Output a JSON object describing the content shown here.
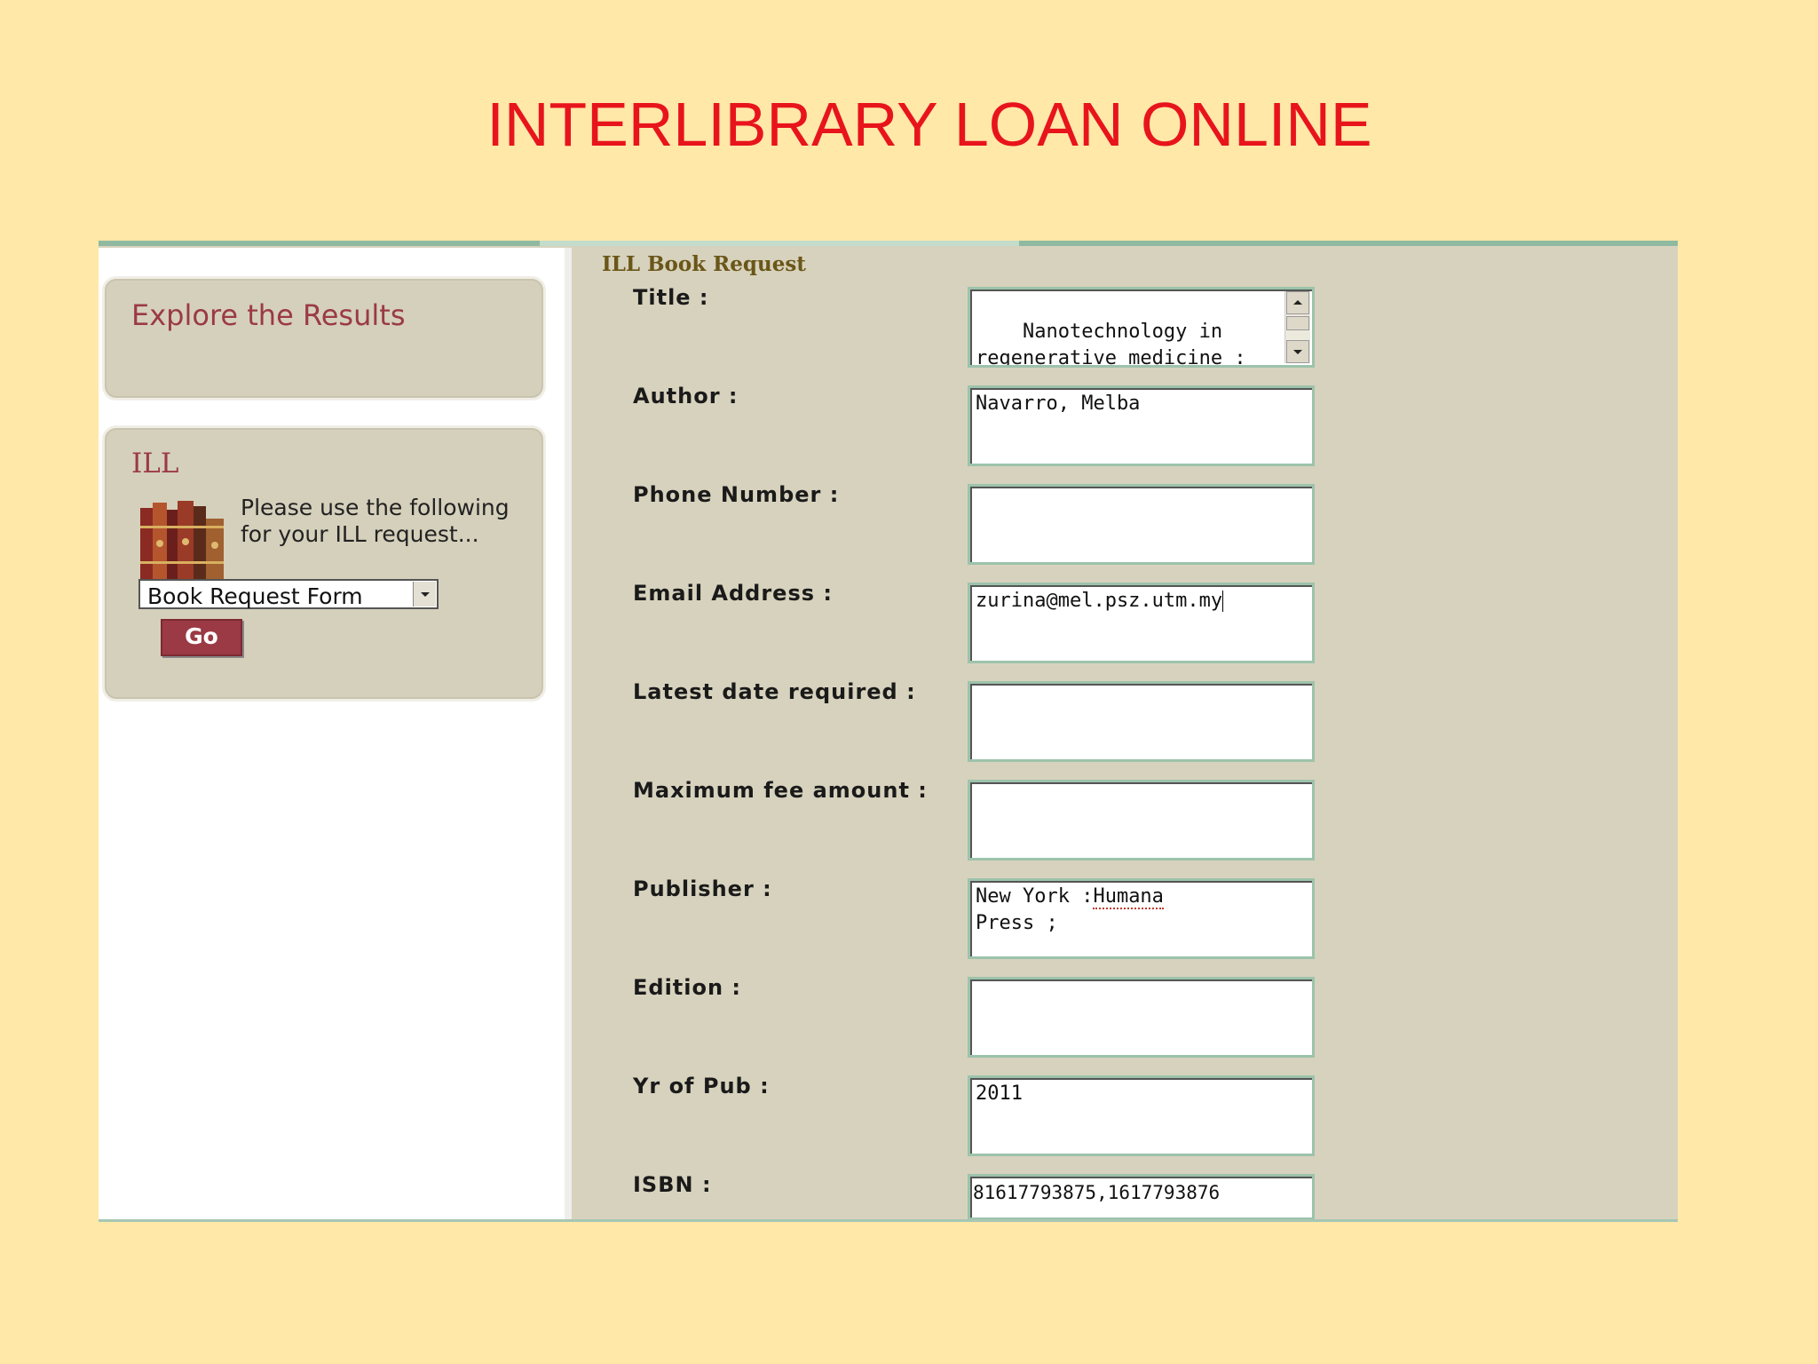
{
  "slide": {
    "title": "INTERLIBRARY LOAN ONLINE"
  },
  "sidebar": {
    "explore_heading": "Explore the Results",
    "ill_heading": "ILL",
    "ill_text": "Please use the following for your ILL request...",
    "select_value": "Book Request Form",
    "go_label": "Go"
  },
  "form": {
    "heading": "ILL Book Request",
    "fields": [
      {
        "label": "Title :",
        "value": "Nanotechnology in regenerative medicine : methods"
      },
      {
        "label": "Author :",
        "value": "Navarro, Melba"
      },
      {
        "label": "Phone Number :",
        "value": ""
      },
      {
        "label": "Email Address :",
        "value": "zurina@mel.psz.utm.my"
      },
      {
        "label": "Latest date required :",
        "value": ""
      },
      {
        "label": "Maximum fee amount :",
        "value": ""
      },
      {
        "label": "Publisher :",
        "value_pre": "New York :",
        "value_marked": "Humana",
        "value_post": "Press ;"
      },
      {
        "label": "Edition :",
        "value": ""
      },
      {
        "label": "Yr of Pub :",
        "value": "2011"
      },
      {
        "label": "ISBN :",
        "value": "81617793875,1617793876"
      }
    ]
  },
  "colors": {
    "title_red": "#e8141c",
    "accent_maroon": "#9b3a44",
    "panel_beige": "#d7d2bd",
    "background": "#ffe8a8"
  }
}
